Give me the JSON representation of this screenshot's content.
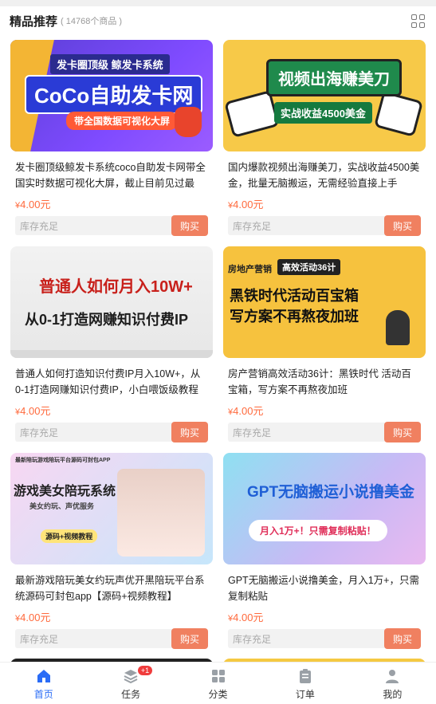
{
  "header": {
    "title": "精品推荐",
    "count": "( 14768个商品 )"
  },
  "products": [
    {
      "title": "发卡圈顶级鲸发卡系统coco自助发卡网带全国实时数据可视化大屏，截止目前见过最牛...",
      "price_symbol": "¥",
      "price": "4.00元",
      "stock": "库存充足",
      "buy": "购买",
      "banner": {
        "line1": "发卡圈顶级  鲸发卡系统",
        "line2": "CoCo自助发卡网",
        "line3": "带全国数据可视化大屏"
      }
    },
    {
      "title": "国内爆款视频出海赚美刀，实战收益4500美金，批量无脑搬运，无需经验直接上手",
      "price_symbol": "¥",
      "price": "4.00元",
      "stock": "库存充足",
      "buy": "购买",
      "banner": {
        "line1": "视频出海赚美刀",
        "line2": "实战收益4500美金"
      }
    },
    {
      "title": "普通人如何打造知识付费IP月入10W+，从0-1打造网赚知识付费IP，小白喂饭级教程",
      "price_symbol": "¥",
      "price": "4.00元",
      "stock": "库存充足",
      "buy": "购买",
      "banner": {
        "line1": "普通人如何月入10W+",
        "line2": "从0-1打造网赚知识付费IP"
      }
    },
    {
      "title": "房产营销高效活动36计：黑铁时代 活动百宝箱，写方案不再熬夜加班",
      "price_symbol": "¥",
      "price": "4.00元",
      "stock": "库存充足",
      "buy": "购买",
      "banner": {
        "tag1": "房地产营销",
        "tag2": "高效活动36计",
        "line1": "黑铁时代活动百宝箱",
        "line2": "写方案不再熬夜加班"
      }
    },
    {
      "title": "最新游戏陪玩美女约玩声优开黑陪玩平台系统源码可封包app【源码+视频教程】",
      "price_symbol": "¥",
      "price": "4.00元",
      "stock": "库存充足",
      "buy": "购买",
      "banner": {
        "top": "最新陪玩游戏陪玩平台源码可封包APP",
        "line1": "游戏美女陪玩系统",
        "line2": "美女约玩、声优服务",
        "line3": "源码+视频教程"
      }
    },
    {
      "title": "GPT无脑搬运小说撸美金，月入1万+，只需复制粘贴",
      "price_symbol": "¥",
      "price": "4.00元",
      "stock": "库存充足",
      "buy": "购买",
      "banner": {
        "line1": "GPT无脑搬运小说撸美金",
        "line2": "月入1万+！只需复制粘贴！"
      }
    }
  ],
  "tabbar": {
    "items": [
      {
        "label": "首页",
        "icon": "home-icon"
      },
      {
        "label": "任务",
        "icon": "layers-icon",
        "badge": "+1"
      },
      {
        "label": "分类",
        "icon": "grid-icon"
      },
      {
        "label": "订单",
        "icon": "clipboard-icon"
      },
      {
        "label": "我的",
        "icon": "user-icon"
      }
    ]
  },
  "colors": {
    "accent": "#2a6cf6",
    "price": "#ff6a3d",
    "buy_button": "#f08060"
  }
}
